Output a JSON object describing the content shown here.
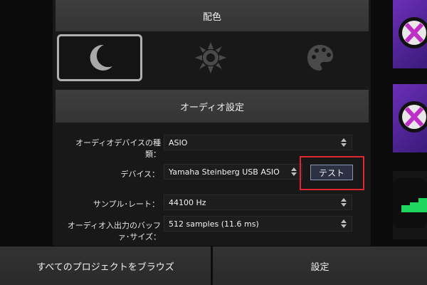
{
  "color_section": {
    "header": "配色",
    "themes": [
      {
        "name": "dark",
        "icon": "moon-icon",
        "selected": true
      },
      {
        "name": "light",
        "icon": "sun-icon",
        "selected": false
      },
      {
        "name": "custom",
        "icon": "palette-icon",
        "selected": false
      }
    ]
  },
  "audio_section": {
    "header": "オーディオ設定",
    "device_type_label": "オーディオデバイスの種類：",
    "device_type_value": "ASIO",
    "device_label": "デバイス：",
    "device_value": "Yamaha Steinberg USB ASIO",
    "test_button": "テスト",
    "sample_rate_label": "サンプル･レート：",
    "sample_rate_value": "44100 Hz",
    "buffer_label": "オーディオ入出力のバッファ･サイズ：",
    "buffer_value": "512 samples (11.6 ms)"
  },
  "bottom_bar": {
    "browse_label": "すべてのプロジェクトをブラウズ",
    "settings_label": "設定"
  },
  "colors": {
    "highlight": "#e0262e",
    "accent_purple": "#6b2fb8",
    "accent_green": "#1ed760"
  }
}
